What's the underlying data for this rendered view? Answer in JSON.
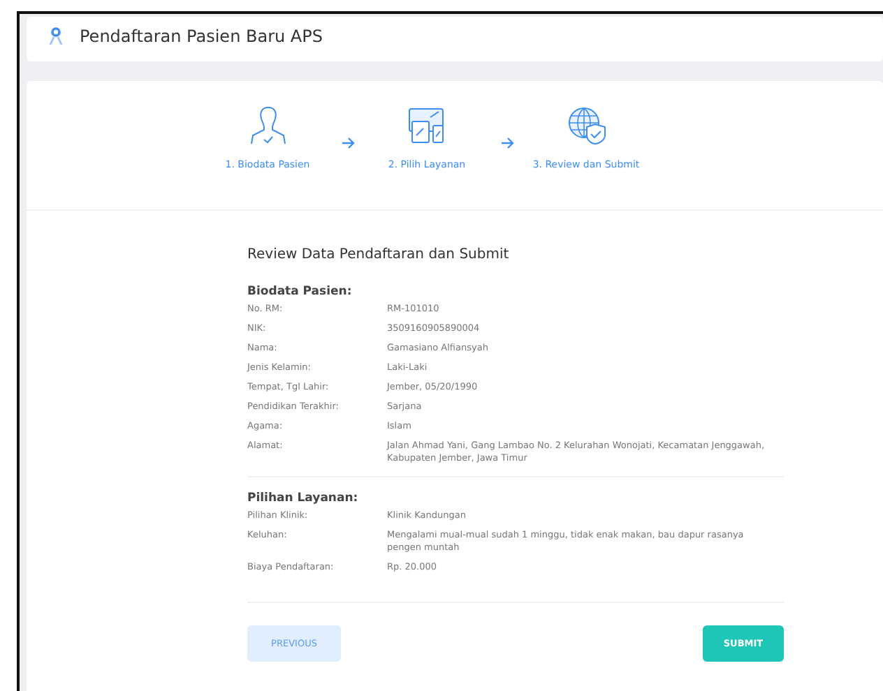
{
  "header": {
    "title": "Pendaftaran Pasien Baru APS"
  },
  "steps": [
    {
      "label": "1. Biodata Pasien",
      "kind": "person"
    },
    {
      "label": "2. Pilih Layanan",
      "kind": "devices"
    },
    {
      "label": "3. Review dan Submit",
      "kind": "globe"
    }
  ],
  "review": {
    "title": "Review Data Pendaftaran dan Submit",
    "sections": [
      {
        "heading": "Biodata Pasien:",
        "rows": [
          {
            "label": "No. RM:",
            "value": "RM-101010"
          },
          {
            "label": "NIK:",
            "value": "3509160905890004"
          },
          {
            "label": "Nama:",
            "value": "Gamasiano Alfiansyah"
          },
          {
            "label": "Jenis Kelamin:",
            "value": "Laki-Laki"
          },
          {
            "label": "Tempat, Tgl Lahir:",
            "value": "Jember, 05/20/1990"
          },
          {
            "label": "Pendidikan Terakhir:",
            "value": "Sarjana"
          },
          {
            "label": "Agama:",
            "value": "Islam"
          },
          {
            "label": "Alamat:",
            "value": "Jalan Ahmad Yani, Gang Lambao No. 2 Kelurahan Wonojati, Kecamatan Jenggawah, Kabupaten Jember, Jawa Timur"
          }
        ]
      },
      {
        "heading": "Pilihan Layanan:",
        "rows": [
          {
            "label": "Pilihan Klinik:",
            "value": "Klinik Kandungan"
          },
          {
            "label": "Keluhan:",
            "value": "Mengalami mual-mual sudah 1 minggu, tidak enak makan, bau dapur rasanya pengen muntah"
          },
          {
            "label": "Biaya Pendaftaran:",
            "value": "Rp. 20.000"
          }
        ]
      }
    ]
  },
  "buttons": {
    "previous": "PREVIOUS",
    "submit": "SUBMIT"
  }
}
